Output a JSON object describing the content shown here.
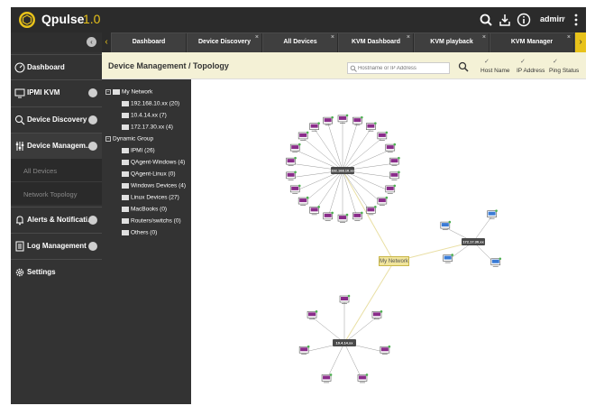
{
  "app": {
    "name": "Qpulse",
    "version": "1.0",
    "user": "admin"
  },
  "colors": {
    "accent": "#e8c21a",
    "sidebar": "#333333",
    "header": "#f4f1d6",
    "online": "#4caf50"
  },
  "sidebar": {
    "items": [
      {
        "label": "Dashboard",
        "icon": "dashboard-icon"
      },
      {
        "label": "IPMI KVM",
        "icon": "monitor-icon"
      },
      {
        "label": "Device Discovery",
        "icon": "discovery-icon"
      },
      {
        "label": "Device Managem...",
        "icon": "sliders-icon"
      },
      {
        "label": "Alerts & Notificati...",
        "icon": "bell-icon"
      },
      {
        "label": "Log Management",
        "icon": "log-icon"
      },
      {
        "label": "Settings",
        "icon": "gear-icon"
      }
    ],
    "subitems": [
      "All Devices",
      "Network Topology"
    ]
  },
  "tabs": [
    {
      "label": "Dashboard"
    },
    {
      "label": "Device Discovery"
    },
    {
      "label": "All Devices"
    },
    {
      "label": "KVM Dashboard"
    },
    {
      "label": "KVM playback"
    },
    {
      "label": "KVM Manager"
    }
  ],
  "content": {
    "title": "Device Management / Topology",
    "search_placeholder": "Hostname or IP Address",
    "checkboxes": [
      {
        "label": "Host Name",
        "checked": true
      },
      {
        "label": "IP Address",
        "checked": true
      },
      {
        "label": "Ping Status",
        "checked": true
      }
    ]
  },
  "tree": {
    "root": "My Network",
    "networks": [
      "192.168.10.xx (20)",
      "10.4.14.xx (7)",
      "172.17.30.xx (4)"
    ],
    "group": "Dynamic Group",
    "groups": [
      "IPMI (26)",
      "QAgent-Windows (4)",
      "QAgent-Linux (0)",
      "Windows Devices (4)",
      "Linux Devices (27)",
      "MacBooks (0)",
      "Routers/switchs (0)",
      "Others (0)"
    ]
  },
  "topology": {
    "root_label": "My Network",
    "hubs": [
      "192.168.10.xx",
      "10.4.14.xx",
      "172.17.30.xx"
    ]
  }
}
